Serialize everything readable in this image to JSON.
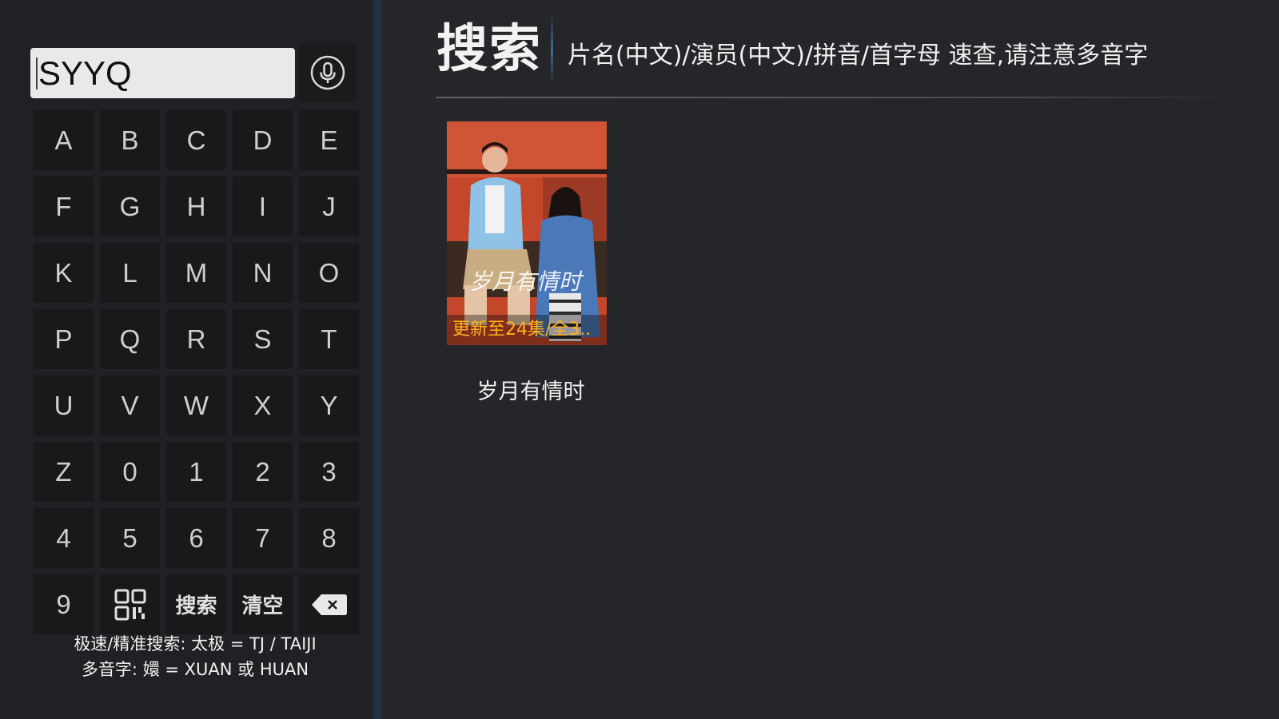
{
  "search": {
    "query": "SYYQ",
    "heading": "搜索",
    "hint": "片名(中文)/演员(中文)/拼音/首字母 速查,请注意多音字"
  },
  "keyboard": {
    "keys": [
      "A",
      "B",
      "C",
      "D",
      "E",
      "F",
      "G",
      "H",
      "I",
      "J",
      "K",
      "L",
      "M",
      "N",
      "O",
      "P",
      "Q",
      "R",
      "S",
      "T",
      "U",
      "V",
      "W",
      "X",
      "Y",
      "Z",
      "0",
      "1",
      "2",
      "3",
      "4",
      "5",
      "6",
      "7",
      "8",
      "9"
    ],
    "search_label": "搜索",
    "clear_label": "清空",
    "icons": {
      "mic": "microphone-icon",
      "qr": "qr-code-icon",
      "backspace": "backspace-icon"
    }
  },
  "hints": {
    "fast_search": "极速/精准搜索: 太极 = TJ / TAIJI",
    "polyphone": "多音字: 嬛 = XUAN 或 HUAN"
  },
  "results": [
    {
      "title": "岁月有情时",
      "badge": "更新至24集/全3..",
      "poster_text": "岁月有情时"
    }
  ],
  "colors": {
    "background": "#25262a",
    "left_panel": "#202124",
    "key": "#18191b",
    "badge_text": "#ffb21c",
    "accent_divider": "#3e6d95"
  }
}
